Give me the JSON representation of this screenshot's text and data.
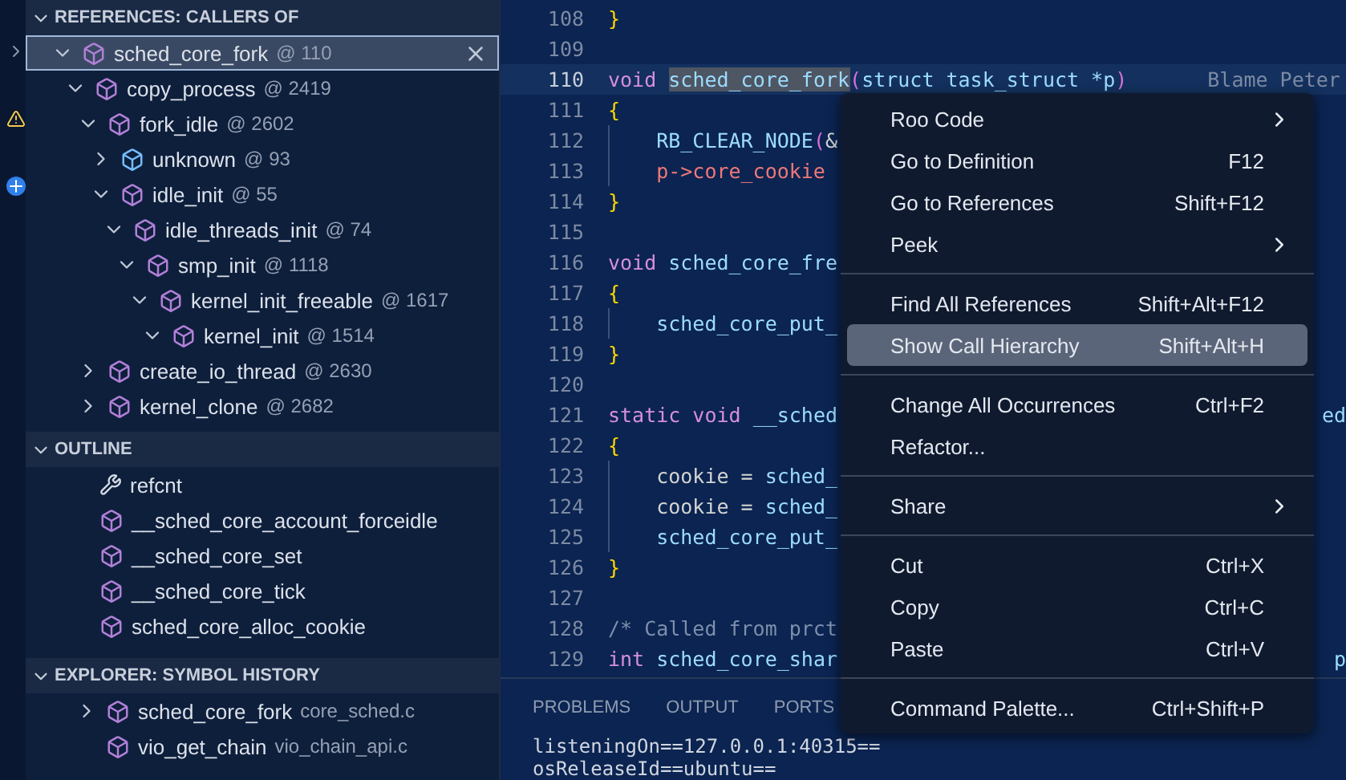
{
  "references": {
    "title": "REFERENCES: CALLERS OF",
    "items": [
      {
        "name": "sched_core_fork",
        "line": "@ 110",
        "kind": "function",
        "expanded": true,
        "selected": true,
        "children": [
          {
            "name": "copy_process",
            "line": "@ 2419",
            "kind": "function",
            "expanded": true,
            "selected": false,
            "children": [
              {
                "name": "fork_idle",
                "line": "@ 2602",
                "kind": "function",
                "expanded": true,
                "selected": false,
                "children": [
                  {
                    "name": "unknown",
                    "line": "@ 93",
                    "kind": "unknown",
                    "expanded": false,
                    "selected": false
                  },
                  {
                    "name": "idle_init",
                    "line": "@ 55",
                    "kind": "function",
                    "expanded": true,
                    "selected": false,
                    "children": [
                      {
                        "name": "idle_threads_init",
                        "line": "@ 74",
                        "kind": "function",
                        "expanded": true,
                        "selected": false,
                        "children": [
                          {
                            "name": "smp_init",
                            "line": "@ 1118",
                            "kind": "function",
                            "expanded": true,
                            "selected": false,
                            "children": [
                              {
                                "name": "kernel_init_freeable",
                                "line": "@ 1617",
                                "kind": "function",
                                "expanded": true,
                                "selected": false,
                                "children": [
                                  {
                                    "name": "kernel_init",
                                    "line": "@ 1514",
                                    "kind": "function",
                                    "expanded": true,
                                    "selected": false
                                  }
                                ]
                              }
                            ]
                          }
                        ]
                      }
                    ]
                  }
                ]
              },
              {
                "name": "create_io_thread",
                "line": "@ 2630",
                "kind": "function",
                "expanded": false,
                "selected": false
              },
              {
                "name": "kernel_clone",
                "line": "@ 2682",
                "kind": "function",
                "expanded": false,
                "selected": false
              }
            ]
          }
        ]
      }
    ]
  },
  "outline": {
    "title": "OUTLINE",
    "items": [
      {
        "name": "refcnt",
        "kind": "field"
      },
      {
        "name": "__sched_core_account_forceidle",
        "kind": "function"
      },
      {
        "name": "__sched_core_set",
        "kind": "function"
      },
      {
        "name": "__sched_core_tick",
        "kind": "function"
      },
      {
        "name": "sched_core_alloc_cookie",
        "kind": "function"
      }
    ]
  },
  "symbol_history": {
    "title": "EXPLORER: SYMBOL HISTORY",
    "items": [
      {
        "name": "sched_core_fork",
        "file": "core_sched.c",
        "expandable": true
      },
      {
        "name": "vio_get_chain",
        "file": "vio_chain_api.c",
        "expandable": false
      }
    ]
  },
  "editor": {
    "lines": [
      {
        "number": "108",
        "current": false,
        "tokens": [
          {
            "kind": "brace",
            "text": "}"
          }
        ]
      },
      {
        "number": "109",
        "current": false
      },
      {
        "number": "110",
        "current": true,
        "blame": "Blame Peter",
        "tokens": [
          {
            "kind": "keyword",
            "text": "void "
          },
          {
            "kind": "selection",
            "text": "sched_core_fork"
          },
          {
            "kind": "paren",
            "text": "("
          },
          {
            "kind": "name",
            "text": "struct task_struct *p"
          },
          {
            "kind": "paren",
            "text": ")"
          }
        ]
      },
      {
        "number": "111",
        "current": false,
        "tokens": [
          {
            "kind": "brace",
            "text": "{"
          }
        ]
      },
      {
        "number": "112",
        "current": false,
        "tokens": [
          {
            "kind": "name",
            "text": "    RB_CLEAR_NODE"
          },
          {
            "kind": "paren",
            "text": "("
          },
          {
            "kind": "plain",
            "text": "&"
          }
        ]
      },
      {
        "number": "113",
        "current": false,
        "tokens": [
          {
            "kind": "field",
            "text": "    p->core_cookie"
          }
        ]
      },
      {
        "number": "114",
        "current": false,
        "tokens": [
          {
            "kind": "brace",
            "text": "}"
          }
        ]
      },
      {
        "number": "115",
        "current": false
      },
      {
        "number": "116",
        "current": false,
        "tokens": [
          {
            "kind": "keyword",
            "text": "void "
          },
          {
            "kind": "name",
            "text": "sched_core_fre"
          }
        ]
      },
      {
        "number": "117",
        "current": false,
        "tokens": [
          {
            "kind": "brace",
            "text": "{"
          }
        ]
      },
      {
        "number": "118",
        "current": false,
        "tokens": [
          {
            "kind": "name",
            "text": "    sched_core_put_"
          }
        ]
      },
      {
        "number": "119",
        "current": false,
        "tokens": [
          {
            "kind": "brace",
            "text": "}"
          }
        ]
      },
      {
        "number": "120",
        "current": false
      },
      {
        "number": "121",
        "current": false,
        "tail": "ed",
        "tokens": [
          {
            "kind": "keyword",
            "text": "static void "
          },
          {
            "kind": "name",
            "text": "__sched"
          }
        ]
      },
      {
        "number": "122",
        "current": false,
        "tokens": [
          {
            "kind": "brace",
            "text": "{"
          }
        ]
      },
      {
        "number": "123",
        "current": false,
        "tokens": [
          {
            "kind": "plain",
            "text": "    cookie = "
          },
          {
            "kind": "name",
            "text": "sched_"
          }
        ]
      },
      {
        "number": "124",
        "current": false,
        "tokens": [
          {
            "kind": "plain",
            "text": "    cookie = "
          },
          {
            "kind": "name",
            "text": "sched_"
          }
        ]
      },
      {
        "number": "125",
        "current": false,
        "tokens": [
          {
            "kind": "name",
            "text": "    sched_core_put_"
          }
        ]
      },
      {
        "number": "126",
        "current": false,
        "tokens": [
          {
            "kind": "brace",
            "text": "}"
          }
        ]
      },
      {
        "number": "127",
        "current": false
      },
      {
        "number": "128",
        "current": false,
        "tokens": [
          {
            "kind": "comment",
            "text": "/* Called from prct"
          }
        ]
      },
      {
        "number": "129",
        "current": false,
        "tail": "p",
        "tokens": [
          {
            "kind": "keyword",
            "text": "int "
          },
          {
            "kind": "name",
            "text": "sched_core_shar"
          }
        ]
      }
    ]
  },
  "panel": {
    "tabs": [
      "PROBLEMS",
      "OUTPUT",
      "PORTS"
    ],
    "output": [
      "listeningOn==127.0.0.1:40315==",
      "osReleaseId==ubuntu=="
    ]
  },
  "context_menu": {
    "groups": [
      [
        {
          "label": "Roo Code",
          "submenu": true,
          "selected": false
        },
        {
          "label": "Go to Definition",
          "shortcut": "F12",
          "submenu": false,
          "selected": false
        },
        {
          "label": "Go to References",
          "shortcut": "Shift+F12",
          "submenu": false,
          "selected": false
        },
        {
          "label": "Peek",
          "submenu": true,
          "selected": false
        }
      ],
      [
        {
          "label": "Find All References",
          "shortcut": "Shift+Alt+F12",
          "submenu": false,
          "selected": false
        },
        {
          "label": "Show Call Hierarchy",
          "shortcut": "Shift+Alt+H",
          "submenu": false,
          "selected": true
        }
      ],
      [
        {
          "label": "Change All Occurrences",
          "shortcut": "Ctrl+F2",
          "submenu": false,
          "selected": false
        },
        {
          "label": "Refactor...",
          "submenu": false,
          "selected": false
        }
      ],
      [
        {
          "label": "Share",
          "submenu": true,
          "selected": false
        }
      ],
      [
        {
          "label": "Cut",
          "shortcut": "Ctrl+X",
          "submenu": false,
          "selected": false
        },
        {
          "label": "Copy",
          "shortcut": "Ctrl+C",
          "submenu": false,
          "selected": false
        },
        {
          "label": "Paste",
          "shortcut": "Ctrl+V",
          "submenu": false,
          "selected": false
        }
      ],
      [
        {
          "label": "Command Palette...",
          "shortcut": "Ctrl+Shift+P",
          "submenu": false,
          "selected": false
        }
      ]
    ]
  }
}
